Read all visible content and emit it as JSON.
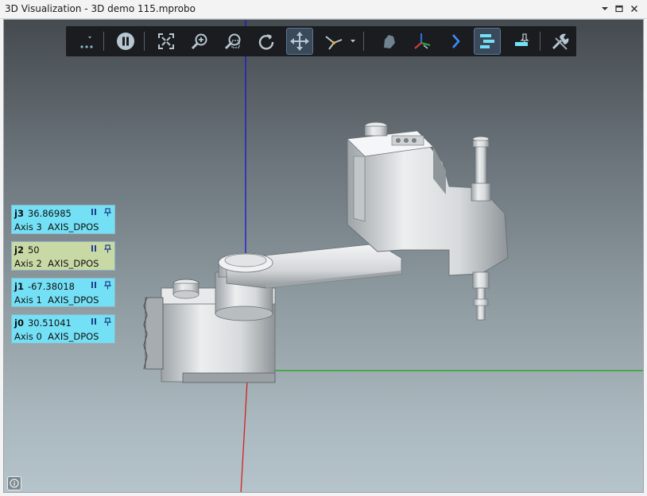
{
  "window": {
    "title": "3D Visualization - 3D demo 115.mprobo"
  },
  "toolbar": {
    "buttons": [
      {
        "name": "more-options",
        "icon": "ellipsis-dropdown-icon"
      },
      {
        "name": "pause",
        "icon": "pause-icon"
      },
      {
        "name": "zoom-extents",
        "icon": "fit-to-view-icon"
      },
      {
        "name": "zoom-in",
        "icon": "zoom-in-icon"
      },
      {
        "name": "zoom-window",
        "icon": "zoom-window-icon"
      },
      {
        "name": "rotate",
        "icon": "rotate-icon"
      },
      {
        "name": "pan",
        "icon": "move-icon",
        "active": true
      },
      {
        "name": "coordinate-system",
        "icon": "coordinate-dropdown-icon"
      },
      {
        "name": "object-view",
        "icon": "object-shape-icon"
      },
      {
        "name": "show-axes",
        "icon": "axes-triad-icon"
      },
      {
        "name": "expand",
        "icon": "chevron-right-icon"
      },
      {
        "name": "axis-panels",
        "icon": "panels-icon",
        "active": true
      },
      {
        "name": "pin-panel",
        "icon": "pin-panel-icon"
      },
      {
        "name": "settings",
        "icon": "tools-icon"
      }
    ]
  },
  "axes_panels": [
    {
      "joint": "j3",
      "value": "36.86985",
      "axis": "Axis 3",
      "signal": "AXIS_DPOS",
      "color": "#74e0f6"
    },
    {
      "joint": "j2",
      "value": "50",
      "axis": "Axis 2",
      "signal": "AXIS_DPOS",
      "color": "#c9d9a6"
    },
    {
      "joint": "j1",
      "value": "-67.38018",
      "axis": "Axis 1",
      "signal": "AXIS_DPOS",
      "color": "#74e0f6"
    },
    {
      "joint": "j0",
      "value": "30.51041",
      "axis": "Axis 0",
      "signal": "AXIS_DPOS",
      "color": "#74e0f6"
    }
  ],
  "colors": {
    "accent": "#6fd3ea",
    "toolbar_bg": "#1a1c1f",
    "axis_x": "#d22020",
    "axis_y": "#16a316",
    "axis_z": "#1616d0"
  }
}
